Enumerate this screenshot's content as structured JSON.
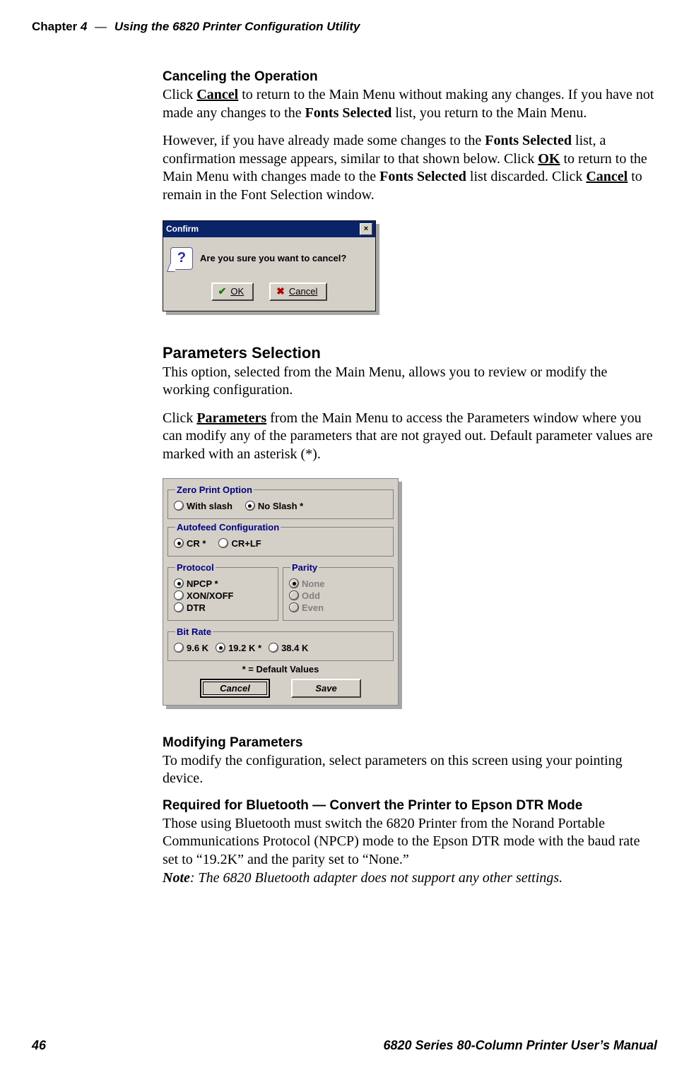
{
  "header": {
    "chapter_label": "Chapter",
    "chapter_number": "4",
    "title": "Using the 6820 Printer Configuration Utility"
  },
  "section_cancel": {
    "heading": "Canceling the  Operation",
    "p1_a": "Click ",
    "p1_cancel": "Cancel",
    "p1_b": " to return to the Main Menu without making any changes. If you have not made any changes to the ",
    "p1_fonts": "Fonts Selected",
    "p1_c": " list, you return to the Main Menu.",
    "p2_a": "However, if you have already made some changes to the ",
    "p2_fonts1": "Fonts Selected",
    "p2_b": " list, a confirmation message appears, similar to that shown below. Click ",
    "p2_ok": "OK",
    "p2_c": " to return to the Main Menu with changes made to the ",
    "p2_fonts2": "Fonts Selected",
    "p2_d": " list discarded. Click ",
    "p2_cancel": "Cancel",
    "p2_e": " to remain in the Font Selection window."
  },
  "confirm_dialog": {
    "title": "Confirm",
    "message": "Are you sure you want to cancel?",
    "ok": "OK",
    "cancel": "Cancel"
  },
  "section_params": {
    "heading": "Parameters Selection",
    "p1": "This option, selected from the Main Menu, allows you to review or modify the working configuration.",
    "p2_a": "Click ",
    "p2_bold": "Parameters",
    "p2_b": " from the Main Menu to access the Parameters window where you can modify any of the parameters that are not grayed out. Default parameter values are marked with an asterisk (*)."
  },
  "params_panel": {
    "zero_legend": "Zero Print Option",
    "zero_with": "With slash",
    "zero_no": "No Slash *",
    "auto_legend": "Autofeed Configuration",
    "auto_cr": "CR *",
    "auto_crlf": "CR+LF",
    "proto_legend": "Protocol",
    "proto_npcp": "NPCP *",
    "proto_xon": "XON/XOFF",
    "proto_dtr": "DTR",
    "parity_legend": "Parity",
    "parity_none": "None",
    "parity_odd": "Odd",
    "parity_even": "Even",
    "bit_legend": "Bit Rate",
    "bit_96": "9.6 K",
    "bit_192": "19.2 K *",
    "bit_384": "38.4 K",
    "default_note": "* = Default Values",
    "btn_cancel": "Cancel",
    "btn_save": "Save"
  },
  "section_modify": {
    "heading": "Modifying Parameters",
    "p1": "To modify the configuration, select parameters on this screen using your pointing device."
  },
  "section_bt": {
    "heading": "Required for Bluetooth — Convert the Printer to Epson DTR Mode",
    "p1": "Those using Bluetooth must switch the 6820 Printer from the Norand Portable Communications Protocol (NPCP) mode to the Epson DTR mode with the baud rate set to “19.2K” and the parity set to “None.”",
    "note_label": "Note",
    "note_body": ": The 6820 Bluetooth adapter does not support any other settings."
  },
  "footer": {
    "page": "46",
    "right": "6820 Series 80-Column Printer User’s Manual"
  }
}
